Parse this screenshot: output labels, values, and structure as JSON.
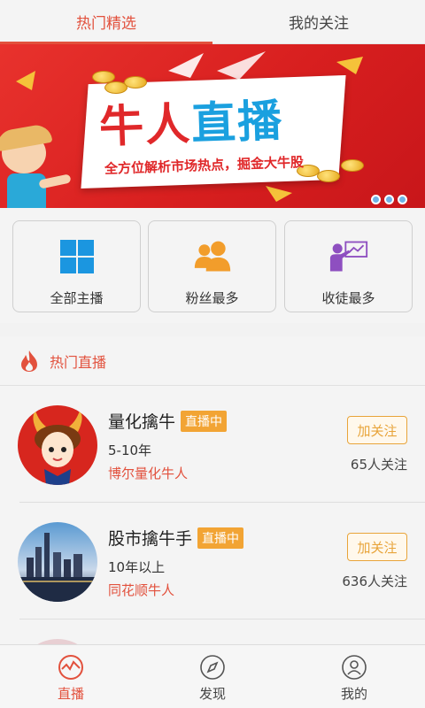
{
  "tabs": [
    {
      "label": "热门精选",
      "active": true
    },
    {
      "label": "我的关注",
      "active": false
    }
  ],
  "banner": {
    "title_part1": "牛人",
    "title_part2": "直播",
    "subtitle": "全方位解析市场热点，掘金大牛股",
    "page_count": 3
  },
  "categories": [
    {
      "label": "全部主播",
      "icon": "grid-icon",
      "color": "#1b96e0"
    },
    {
      "label": "粉丝最多",
      "icon": "users-icon",
      "color": "#f29d2b"
    },
    {
      "label": "收徒最多",
      "icon": "teacher-icon",
      "color": "#8e4fc0"
    }
  ],
  "section": {
    "title": "热门直播",
    "icon": "flame-icon"
  },
  "streamers": [
    {
      "name": "量化擒牛",
      "badge": "直播中",
      "experience": "5-10年",
      "source": "博尔量化牛人",
      "follow_label": "加关注",
      "fans": "65人关注"
    },
    {
      "name": "股市擒牛手",
      "badge": "直播中",
      "experience": "10年以上",
      "source": "同花顺牛人",
      "follow_label": "加关注",
      "fans": "636人关注"
    }
  ],
  "bottom_nav": [
    {
      "label": "直播",
      "icon": "live-chart-icon",
      "active": true
    },
    {
      "label": "发现",
      "icon": "compass-icon",
      "active": false
    },
    {
      "label": "我的",
      "icon": "profile-icon",
      "active": false
    }
  ],
  "colors": {
    "accent": "#e2513d",
    "badge": "#f2a434",
    "follow": "#e8a43a"
  }
}
